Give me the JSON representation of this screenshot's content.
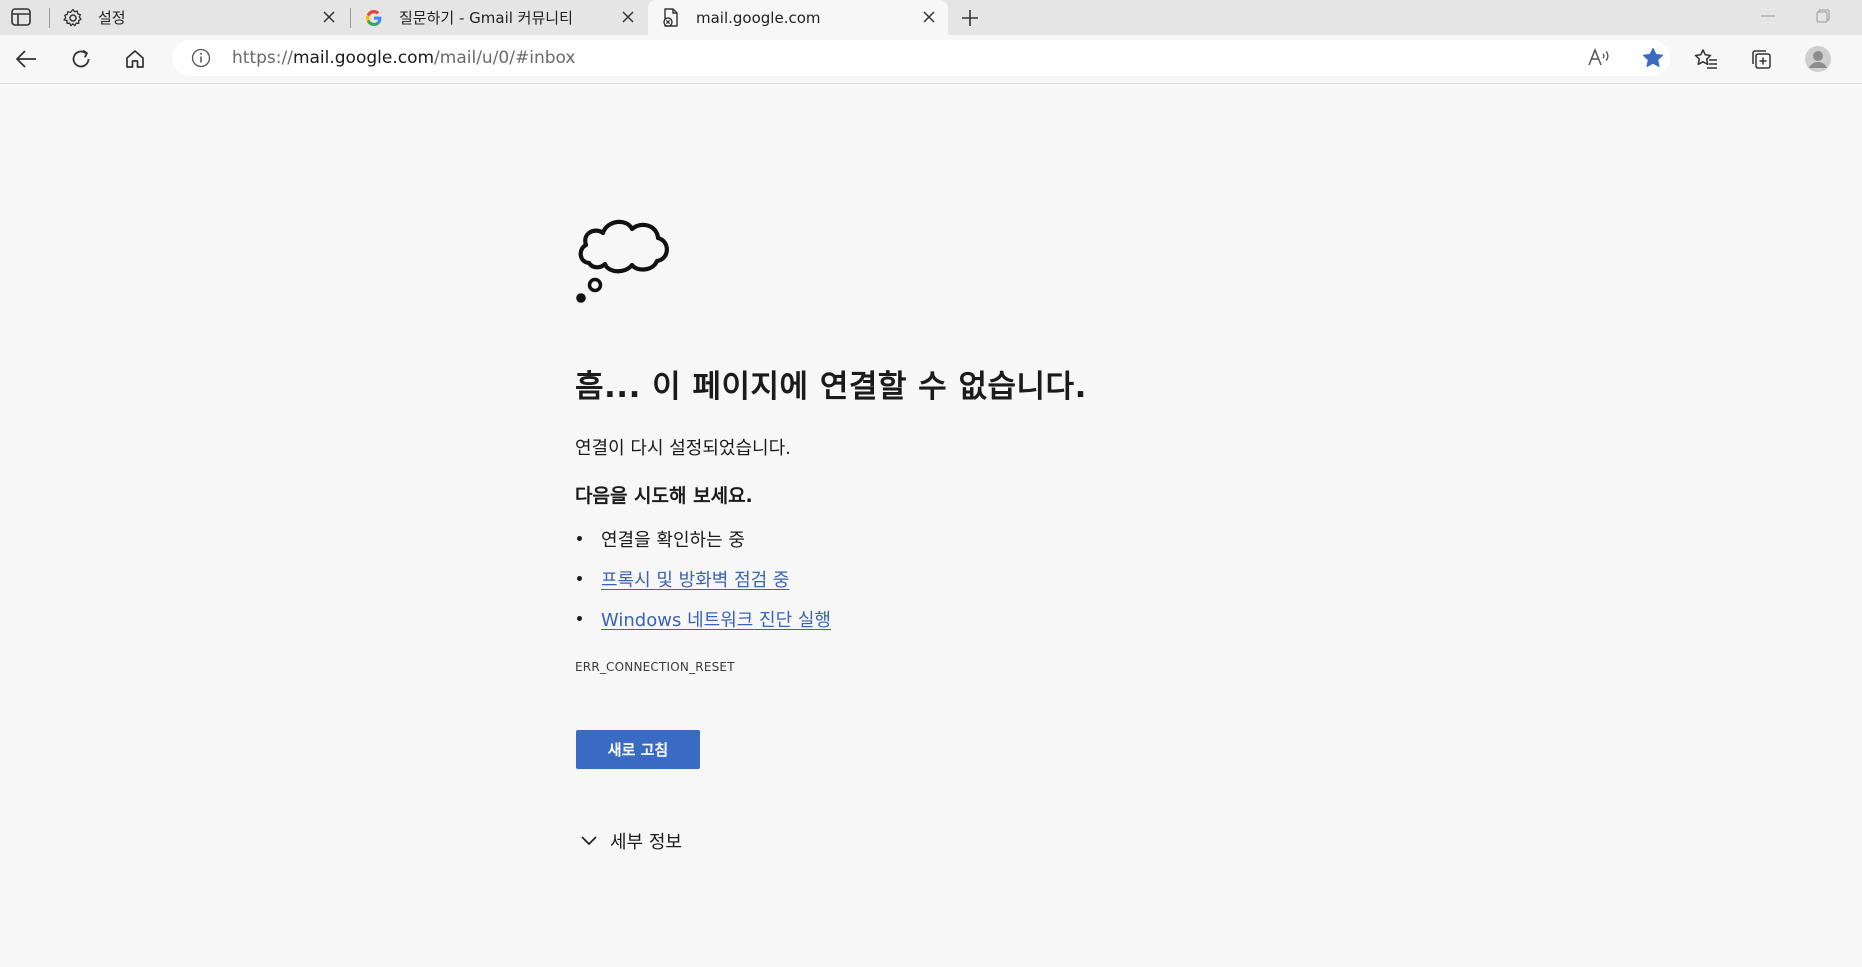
{
  "browser": {
    "tabs": [
      {
        "title": "설정",
        "favicon": "gear-icon",
        "active": false
      },
      {
        "title": "질문하기 - Gmail 커뮤니티",
        "favicon": "google-g-icon",
        "active": false
      },
      {
        "title": "mail.google.com",
        "favicon": "broken-page-icon",
        "active": true
      }
    ],
    "address": {
      "scheme": "https://",
      "host": "mail.google.com",
      "path": "/mail/u/0/#inbox"
    },
    "favorite_star_color": "#3a6bc2"
  },
  "error_page": {
    "illustration": "thought-cloud-icon",
    "headline": "흠... 이 페이지에 연결할 수 없습니다.",
    "subtext": "연결이 다시 설정되었습니다.",
    "try_heading": "다음을 시도해 보세요.",
    "suggestions": [
      {
        "text": "연결을 확인하는 중",
        "link": false
      },
      {
        "text": "프록시 및 방화벽 점검 중",
        "link": true
      },
      {
        "text": "Windows 네트워크 진단 실행",
        "link": true
      }
    ],
    "error_code": "ERR_CONNECTION_RESET",
    "reload_label": "새로 고침",
    "details_label": "세부 정보",
    "button_color": "#3a6bc2",
    "link_color": "#3a63b5"
  }
}
